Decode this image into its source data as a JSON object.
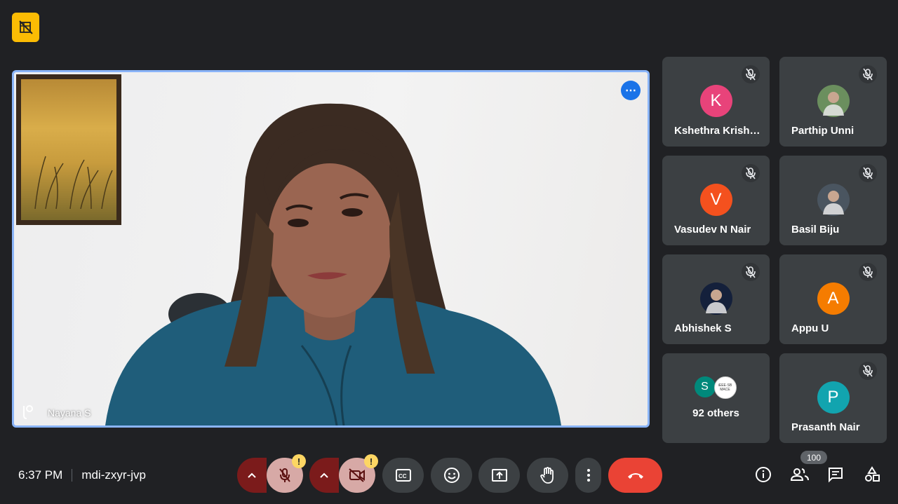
{
  "meeting": {
    "time": "6:37 PM",
    "code": "mdi-zxyr-jvp"
  },
  "main_speaker": {
    "name": "Nayana S"
  },
  "participants": [
    {
      "name": "Kshethra Krish…",
      "initial": "K",
      "color": "#e8437a",
      "muted": true,
      "avatar_type": "initial"
    },
    {
      "name": "Parthip Unni",
      "initial": "",
      "color": "#6b8f5e",
      "muted": true,
      "avatar_type": "photo"
    },
    {
      "name": "Vasudev N Nair",
      "initial": "V",
      "color": "#f4511e",
      "muted": true,
      "avatar_type": "initial"
    },
    {
      "name": "Basil Biju",
      "initial": "",
      "color": "#4a5560",
      "muted": true,
      "avatar_type": "photo"
    },
    {
      "name": "Abhishek S",
      "initial": "",
      "color": "#14203b",
      "muted": true,
      "avatar_type": "photo"
    },
    {
      "name": "Appu U",
      "initial": "A",
      "color": "#f57c00",
      "muted": true,
      "avatar_type": "initial"
    },
    {
      "name": "92 others",
      "initial": "S",
      "color": "#00897b",
      "muted": false,
      "avatar_type": "group"
    },
    {
      "name": "Prasanth Nair",
      "initial": "P",
      "color": "#12a4af",
      "muted": true,
      "avatar_type": "initial"
    }
  ],
  "others_badge_text": "iEEE·SB MACE",
  "controls": {
    "mic_warning": "!",
    "cam_warning": "!"
  },
  "participant_count": "100",
  "colors": {
    "background": "#202124",
    "tile": "#3c4043",
    "accent": "#8ab4f8",
    "end_call": "#ea4335",
    "warning": "#fdd663"
  }
}
